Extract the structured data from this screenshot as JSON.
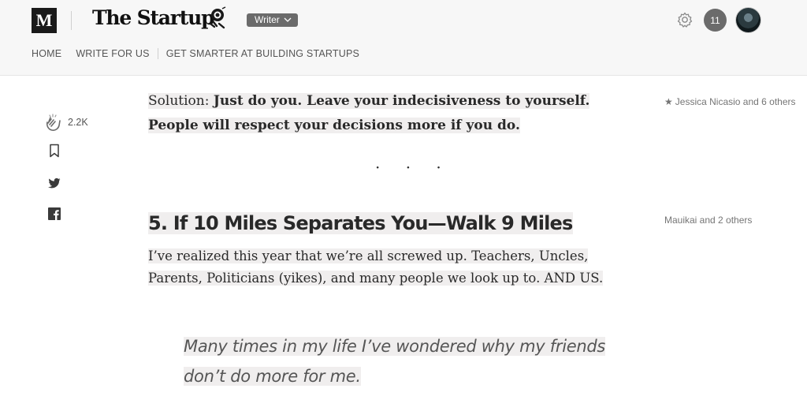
{
  "header": {
    "site_logo": "M",
    "publication_name": "The Startup",
    "writer_badge": "Writer",
    "notification_count": "11"
  },
  "nav": {
    "items": [
      "HOME",
      "WRITE FOR US",
      "GET SMARTER AT BUILDING STARTUPS"
    ]
  },
  "rail": {
    "clap_count": "2.2K",
    "icons": [
      "clap-icon",
      "bookmark-icon",
      "twitter-icon",
      "facebook-icon"
    ]
  },
  "article": {
    "paragraph1_lead": "Solution: ",
    "paragraph1_bold": "Just do you. Leave your indecisiveness to yourself. People will respect your decisions more if you do.",
    "separator": "· · ·",
    "heading": "5. If 10 Miles Separates You—Walk 9 Miles",
    "paragraph2": "I’ve realized this year that we’re all screwed up. Teachers, Uncles, Parents, Politicians (yikes), and many people we look up to. AND US.",
    "quote": "Many times in my life I’ve wondered why my friends don’t do more for me."
  },
  "highlights": {
    "note1": "Jessica Nicasio and 6 others",
    "note2": "Mauikai and 2 others"
  },
  "colors": {
    "header_bg": "#f7f7f7",
    "highlight_bg": "#f0eeee",
    "badge_bg": "#6b6b6b",
    "text": "#292929"
  }
}
